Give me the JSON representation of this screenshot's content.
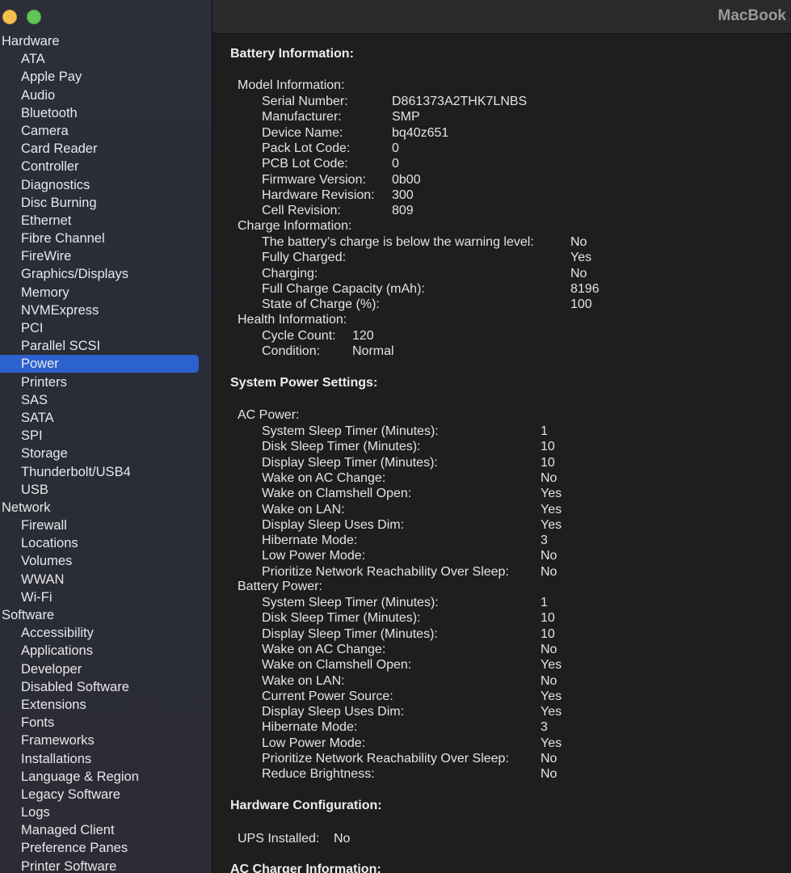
{
  "window": {
    "computer_name": "MacBook"
  },
  "sidebar": {
    "items": [
      {
        "label": "Hardware",
        "type": "cat"
      },
      {
        "label": "ATA",
        "type": "item"
      },
      {
        "label": "Apple Pay",
        "type": "item"
      },
      {
        "label": "Audio",
        "type": "item"
      },
      {
        "label": "Bluetooth",
        "type": "item"
      },
      {
        "label": "Camera",
        "type": "item"
      },
      {
        "label": "Card Reader",
        "type": "item"
      },
      {
        "label": "Controller",
        "type": "item"
      },
      {
        "label": "Diagnostics",
        "type": "item"
      },
      {
        "label": "Disc Burning",
        "type": "item"
      },
      {
        "label": "Ethernet",
        "type": "item"
      },
      {
        "label": "Fibre Channel",
        "type": "item"
      },
      {
        "label": "FireWire",
        "type": "item"
      },
      {
        "label": "Graphics/Displays",
        "type": "item"
      },
      {
        "label": "Memory",
        "type": "item"
      },
      {
        "label": "NVMExpress",
        "type": "item"
      },
      {
        "label": "PCI",
        "type": "item"
      },
      {
        "label": "Parallel SCSI",
        "type": "item"
      },
      {
        "label": "Power",
        "type": "item",
        "selected": true
      },
      {
        "label": "Printers",
        "type": "item"
      },
      {
        "label": "SAS",
        "type": "item"
      },
      {
        "label": "SATA",
        "type": "item"
      },
      {
        "label": "SPI",
        "type": "item"
      },
      {
        "label": "Storage",
        "type": "item"
      },
      {
        "label": "Thunderbolt/USB4",
        "type": "item"
      },
      {
        "label": "USB",
        "type": "item"
      },
      {
        "label": "Network",
        "type": "cat"
      },
      {
        "label": "Firewall",
        "type": "item"
      },
      {
        "label": "Locations",
        "type": "item"
      },
      {
        "label": "Volumes",
        "type": "item"
      },
      {
        "label": "WWAN",
        "type": "item"
      },
      {
        "label": "Wi-Fi",
        "type": "item"
      },
      {
        "label": "Software",
        "type": "cat"
      },
      {
        "label": "Accessibility",
        "type": "item"
      },
      {
        "label": "Applications",
        "type": "item"
      },
      {
        "label": "Developer",
        "type": "item"
      },
      {
        "label": "Disabled Software",
        "type": "item"
      },
      {
        "label": "Extensions",
        "type": "item"
      },
      {
        "label": "Fonts",
        "type": "item"
      },
      {
        "label": "Frameworks",
        "type": "item"
      },
      {
        "label": "Installations",
        "type": "item"
      },
      {
        "label": "Language & Region",
        "type": "item"
      },
      {
        "label": "Legacy Software",
        "type": "item"
      },
      {
        "label": "Logs",
        "type": "item"
      },
      {
        "label": "Managed Client",
        "type": "item"
      },
      {
        "label": "Preference Panes",
        "type": "item"
      },
      {
        "label": "Printer Software",
        "type": "item"
      }
    ]
  },
  "battery_info": {
    "title": "Battery Information:",
    "model_title": "Model Information:",
    "model": [
      {
        "label": "Serial Number:",
        "value": "D861373A2THK7LNBS"
      },
      {
        "label": "Manufacturer:",
        "value": "SMP"
      },
      {
        "label": "Device Name:",
        "value": "bq40z651"
      },
      {
        "label": "Pack Lot Code:",
        "value": "0"
      },
      {
        "label": "PCB Lot Code:",
        "value": "0"
      },
      {
        "label": "Firmware Version:",
        "value": "0b00"
      },
      {
        "label": "Hardware Revision:",
        "value": "300"
      },
      {
        "label": "Cell Revision:",
        "value": "809"
      }
    ],
    "charge_title": "Charge Information:",
    "charge": [
      {
        "label": "The battery’s charge is below the warning level:",
        "value": "No"
      },
      {
        "label": "Fully Charged:",
        "value": "Yes"
      },
      {
        "label": "Charging:",
        "value": "No"
      },
      {
        "label": "Full Charge Capacity (mAh):",
        "value": "8196"
      },
      {
        "label": "State of Charge (%):",
        "value": "100"
      }
    ],
    "health_title": "Health Information:",
    "health": [
      {
        "label": "Cycle Count:",
        "value": "120"
      },
      {
        "label": "Condition:",
        "value": "Normal"
      }
    ]
  },
  "power_settings": {
    "title": "System Power Settings:",
    "ac_title": "AC Power:",
    "ac": [
      {
        "label": "System Sleep Timer (Minutes):",
        "value": "1"
      },
      {
        "label": "Disk Sleep Timer (Minutes):",
        "value": "10"
      },
      {
        "label": "Display Sleep Timer (Minutes):",
        "value": "10"
      },
      {
        "label": "Wake on AC Change:",
        "value": "No"
      },
      {
        "label": "Wake on Clamshell Open:",
        "value": "Yes"
      },
      {
        "label": "Wake on LAN:",
        "value": "Yes"
      },
      {
        "label": "Display Sleep Uses Dim:",
        "value": "Yes"
      },
      {
        "label": "Hibernate Mode:",
        "value": "3"
      },
      {
        "label": "Low Power Mode:",
        "value": "No"
      },
      {
        "label": "Prioritize Network Reachability Over Sleep:",
        "value": "No"
      }
    ],
    "battery_title": "Battery Power:",
    "battery": [
      {
        "label": "System Sleep Timer (Minutes):",
        "value": "1"
      },
      {
        "label": "Disk Sleep Timer (Minutes):",
        "value": "10"
      },
      {
        "label": "Display Sleep Timer (Minutes):",
        "value": "10"
      },
      {
        "label": "Wake on AC Change:",
        "value": "No"
      },
      {
        "label": "Wake on Clamshell Open:",
        "value": "Yes"
      },
      {
        "label": "Wake on LAN:",
        "value": "No"
      },
      {
        "label": "Current Power Source:",
        "value": "Yes"
      },
      {
        "label": "Display Sleep Uses Dim:",
        "value": "Yes"
      },
      {
        "label": "Hibernate Mode:",
        "value": "3"
      },
      {
        "label": "Low Power Mode:",
        "value": "Yes"
      },
      {
        "label": "Prioritize Network Reachability Over Sleep:",
        "value": "No"
      },
      {
        "label": "Reduce Brightness:",
        "value": "No"
      }
    ]
  },
  "hardware_config": {
    "title": "Hardware Configuration:",
    "ups_label": "UPS Installed:",
    "ups_value": "No"
  },
  "ac_charger": {
    "title": "AC Charger Information:"
  }
}
